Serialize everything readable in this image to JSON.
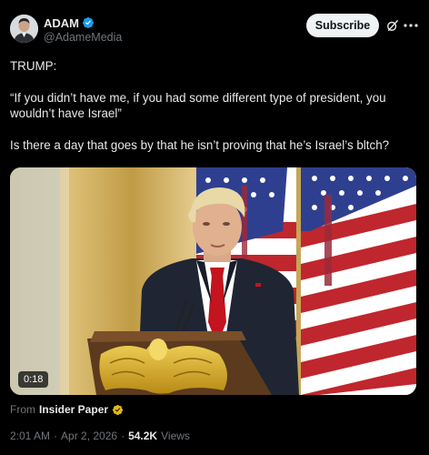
{
  "post": {
    "author": {
      "display_name": "ADAM",
      "handle": "@AdameMedia",
      "verified_icon": "blue-verified-badge-icon",
      "avatar_icon": "avatar-photo"
    },
    "actions": {
      "subscribe_label": "Subscribe",
      "grok_icon": "grok-slash-icon",
      "more_icon": "more-dots-icon"
    },
    "text": {
      "line1": "TRUMP:",
      "line2": "“If you didn’t have me, if you had some different type of president, you wouldn’t have Israel”",
      "line3": "Is there a day that goes by that he isn’t proving that he’s Israel’s bltch?"
    },
    "media": {
      "duration": "0:18",
      "description_icon": "video-thumbnail"
    },
    "source": {
      "prefix": "From",
      "name": "Insider Paper",
      "badge_icon": "gold-verified-badge-icon"
    },
    "meta": {
      "time": "2:01 AM",
      "separator1": "·",
      "date": "Apr 2, 2026",
      "separator2": "·",
      "views_count": "54.2K",
      "views_label": "Views"
    },
    "colors": {
      "background": "#000000",
      "text_primary": "#e7e9ea",
      "text_secondary": "#71767b",
      "verified_blue": "#1d9bf0",
      "verified_gold": "#e2b719",
      "subscribe_bg": "#eff3f4"
    }
  }
}
